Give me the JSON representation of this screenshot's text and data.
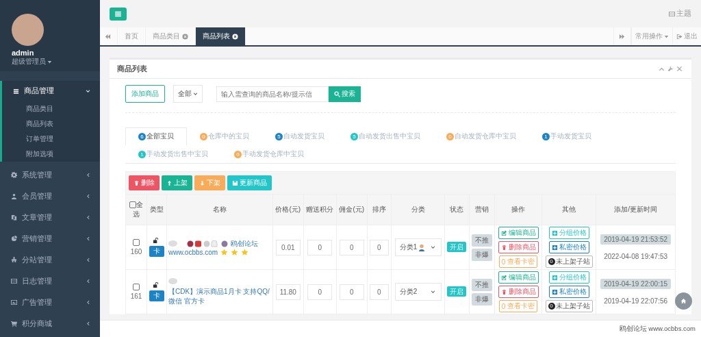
{
  "sidebar": {
    "user": {
      "name": "admin",
      "role": "超级管理员"
    },
    "menu": [
      {
        "label": "商品管理",
        "expanded": true,
        "children": [
          {
            "label": "商品类目"
          },
          {
            "label": "商品列表"
          },
          {
            "label": "订单管理"
          },
          {
            "label": "附加选项"
          }
        ]
      },
      {
        "label": "系统管理",
        "expanded": false
      },
      {
        "label": "会员管理",
        "expanded": false
      },
      {
        "label": "文章管理",
        "expanded": false
      },
      {
        "label": "营销管理",
        "expanded": false
      },
      {
        "label": "分站管理",
        "expanded": false
      },
      {
        "label": "日志管理",
        "expanded": false
      },
      {
        "label": "广告管理",
        "expanded": false
      },
      {
        "label": "积分商城",
        "expanded": false
      }
    ]
  },
  "topbar": {
    "theme_label": "主题"
  },
  "tabs": [
    {
      "label": "首页",
      "selected": false,
      "closable": false
    },
    {
      "label": "商品类目",
      "selected": false,
      "closable": true
    },
    {
      "label": "商品列表",
      "selected": true,
      "closable": true
    }
  ],
  "tab_actions": {
    "menu": "常用操作",
    "logout": "退出"
  },
  "panel": {
    "title": "商品列表",
    "add_button": "添加商品",
    "filter": "全部",
    "search_placeholder": "输入需查询的商品名称/提示信",
    "search_button": "搜索"
  },
  "status_tabs": [
    {
      "count": "6",
      "label": "全部宝贝",
      "color": "#1c84c6",
      "selected": true
    },
    {
      "count": "0",
      "label": "仓库中的宝贝",
      "color": "#f8ac59",
      "selected": false
    },
    {
      "count": "5",
      "label": "自动发货宝贝",
      "color": "#1c84c6",
      "selected": false
    },
    {
      "count": "5",
      "label": "自动发货出售中宝贝",
      "color": "#23c6c8",
      "selected": false
    },
    {
      "count": "0",
      "label": "自动发货仓库中宝贝",
      "color": "#f8ac59",
      "selected": false
    },
    {
      "count": "1",
      "label": "手动发货宝贝",
      "color": "#1c84c6",
      "selected": false
    },
    {
      "count": "1",
      "label": "手动发货出售中宝贝",
      "color": "#23c6c8",
      "selected": false
    },
    {
      "count": "0",
      "label": "手动发货仓库中宝贝",
      "color": "#f8ac59",
      "selected": false
    }
  ],
  "bulk_actions": [
    {
      "label": "删除",
      "kind": "delete"
    },
    {
      "label": "上架",
      "kind": "up"
    },
    {
      "label": "下架",
      "kind": "down"
    },
    {
      "label": "更新商品",
      "kind": "update"
    }
  ],
  "table": {
    "select_all": {
      "label": "全选",
      "checked": false
    },
    "columns": [
      "类型",
      "名称",
      "价格(元)",
      "赠送积分",
      "佣金(元)",
      "排序",
      "分类",
      "状态",
      "营销",
      "操作",
      "其他",
      "添加/更新时间"
    ],
    "rows": [
      {
        "checked": false,
        "id": "160",
        "type": "卡",
        "emoji": true,
        "name": "鸥创论坛",
        "link": "www.ocbbs.com",
        "stars": 3,
        "price": "0.01",
        "points": "0",
        "commission": "0",
        "sort": "0",
        "category": "分类1",
        "category_icon": true,
        "status": "开启",
        "status_on": true,
        "marketing": [
          "不推",
          "非爆"
        ],
        "edit": "编辑商品",
        "delete": "删除商品",
        "cards_count": "0",
        "cards": "查看卡密",
        "group_price": "分组价格",
        "private_price": "私密价格",
        "substation_count": "0",
        "substation": "未上架子站",
        "added": "2019-04-19 21:53:52",
        "updated": "2022-04-08 19:47:53"
      },
      {
        "checked": false,
        "id": "161",
        "type": "卡",
        "emoji": false,
        "name": "【CDK】演示商品1月卡 支持QQ/微信 官方卡",
        "link": "",
        "stars": 0,
        "price": "11.80",
        "points": "0",
        "commission": "0",
        "sort": "0",
        "category": "分类2",
        "category_icon": false,
        "status": "开启",
        "status_on": true,
        "marketing": [
          "不推",
          "非爆"
        ],
        "edit": "编辑商品",
        "delete": "删除商品",
        "cards_count": "0",
        "cards": "查看卡密",
        "group_price": "分组价格",
        "private_price": "私密价格",
        "substation_count": "0",
        "substation": "未上架子站",
        "added": "2019-04-19 22:00:15",
        "updated": "2019-04-19 22:07:56"
      }
    ]
  },
  "footer": "鸥创论坛 www.ocbbs.com"
}
